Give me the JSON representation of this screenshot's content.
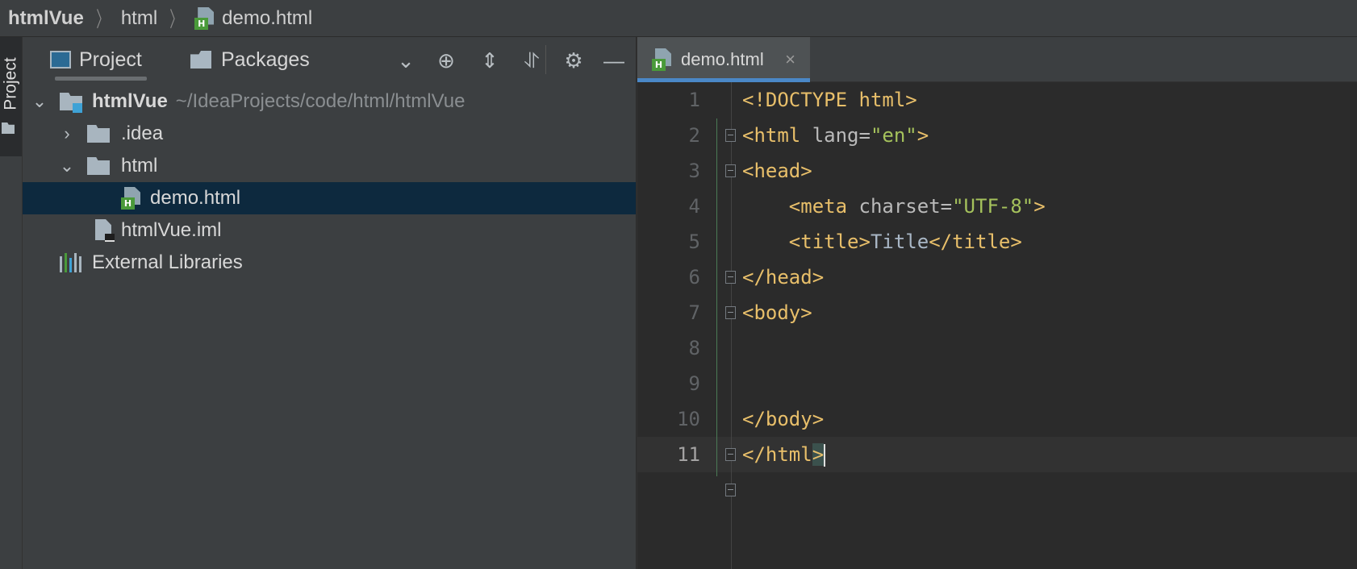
{
  "breadcrumb": {
    "project": "htmlVue",
    "folder": "html",
    "file": "demo.html",
    "separator": "〉"
  },
  "left_strip": {
    "tab_label": "Project"
  },
  "project_panel": {
    "tabs": [
      {
        "label": "Project",
        "active": true
      },
      {
        "label": "Packages",
        "active": false
      }
    ],
    "header_icons": [
      "chevron-down-icon",
      "locate-icon",
      "expand-all-icon",
      "collapse-all-icon",
      "gear-icon",
      "minimize-icon"
    ],
    "tree": {
      "root": {
        "label": "htmlVue",
        "path": "~/IdeaProjects/code/html/htmlVue"
      },
      "items": [
        {
          "label": ".idea",
          "type": "folder",
          "expanded": false
        },
        {
          "label": "html",
          "type": "folder",
          "expanded": true
        },
        {
          "label": "demo.html",
          "type": "html-file",
          "selected": true
        },
        {
          "label": "htmlVue.iml",
          "type": "iml-file"
        },
        {
          "label": "External Libraries",
          "type": "libraries"
        }
      ]
    }
  },
  "editor": {
    "tab": {
      "label": "demo.html",
      "close": "×",
      "file_badge": "H"
    },
    "line_numbers": [
      "1",
      "2",
      "3",
      "4",
      "5",
      "6",
      "7",
      "8",
      "9",
      "10",
      "11"
    ],
    "current_line": "11",
    "code": {
      "l1": "<!DOCTYPE html>",
      "l2_open": "<html ",
      "l2_attr": "lang=",
      "l2_val": "\"en\"",
      "l2_close": ">",
      "l3": "<head>",
      "l4_open": "    <meta ",
      "l4_attr": "charset=",
      "l4_val": "\"UTF-8\"",
      "l4_close": ">",
      "l5_open": "    <title>",
      "l5_text": "Title",
      "l5_close": "</title>",
      "l6": "</head>",
      "l7": "<body>",
      "l10": "</body>",
      "l11_open": "</html",
      "l11_close": ">"
    }
  },
  "colors": {
    "background": "#2b2b2b",
    "panel": "#3c3f41",
    "selection": "#0d293e",
    "tag": "#e8bf6a",
    "attribute_value": "#a5c25c",
    "active_tab_underline": "#4a88c7"
  }
}
